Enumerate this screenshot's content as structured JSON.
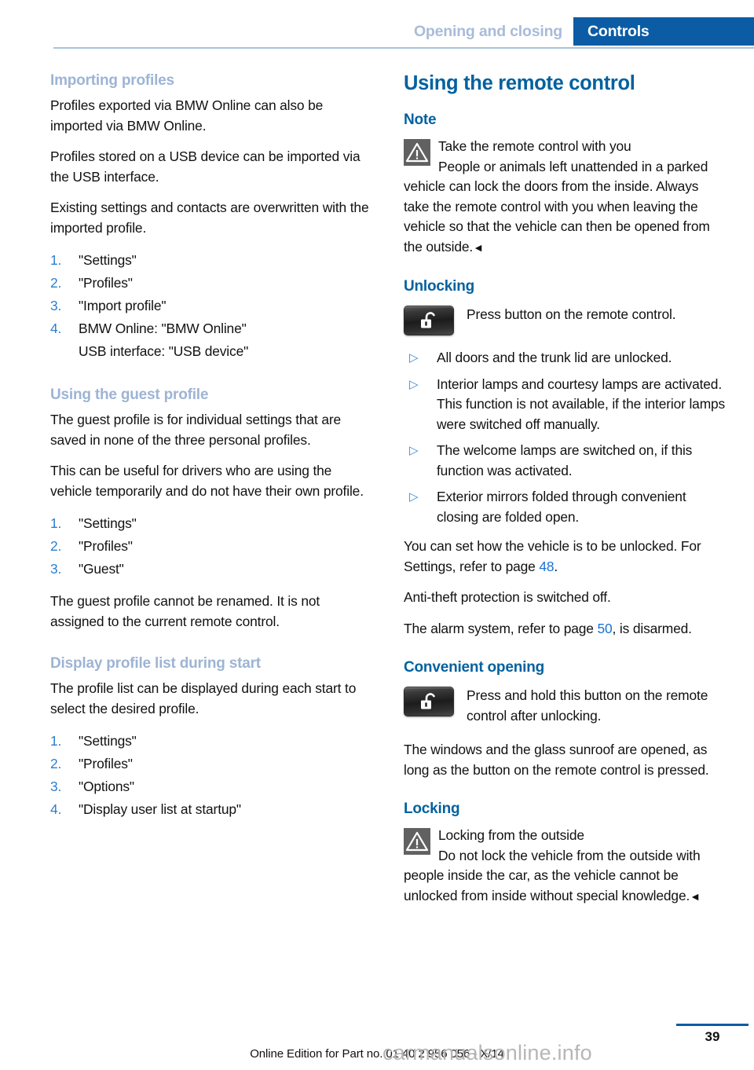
{
  "header": {
    "tab_inactive": "Opening and closing",
    "tab_active": "Controls"
  },
  "left_column": {
    "section_importing": {
      "heading": "Importing profiles",
      "paragraphs": [
        "Profiles exported via BMW Online can also be imported via BMW Online.",
        "Profiles stored on a USB device can be im­ported via the USB interface.",
        "Existing settings and contacts are overwritten with the imported profile."
      ],
      "steps": [
        {
          "num": "1.",
          "text": "\"Settings\""
        },
        {
          "num": "2.",
          "text": "\"Profiles\""
        },
        {
          "num": "3.",
          "text": "\"Import profile\""
        },
        {
          "num": "4.",
          "text": "BMW Online: \"BMW Online\""
        }
      ],
      "step_continuation": "USB interface: \"USB device\""
    },
    "section_guest": {
      "heading": "Using the guest profile",
      "paragraphs": [
        "The guest profile is for individual settings that are saved in none of the three personal pro­files.",
        "This can be useful for drivers who are using the vehicle temporarily and do not have their own profile."
      ],
      "steps": [
        {
          "num": "1.",
          "text": "\"Settings\""
        },
        {
          "num": "2.",
          "text": "\"Profiles\""
        },
        {
          "num": "3.",
          "text": "\"Guest\""
        }
      ],
      "closing": "The guest profile cannot be renamed. It is not assigned to the current remote control."
    },
    "section_display_list": {
      "heading": "Display profile list during start",
      "intro": "The profile list can be displayed during each start to select the desired profile.",
      "steps": [
        {
          "num": "1.",
          "text": "\"Settings\""
        },
        {
          "num": "2.",
          "text": "\"Profiles\""
        },
        {
          "num": "3.",
          "text": "\"Options\""
        },
        {
          "num": "4.",
          "text": "\"Display user list at startup\""
        }
      ]
    }
  },
  "right_column": {
    "title": "Using the remote control",
    "note": {
      "heading": "Note",
      "warning_title": "Take the remote control with you",
      "warning_body": "People or animals left unattended in a parked vehicle can lock the doors from the in­side. Always take the remote control with you when leaving the vehicle so that the vehicle can then be opened from the outside.",
      "end_mark": "◄"
    },
    "unlocking": {
      "heading": "Unlocking",
      "button_text": "Press button on the remote control.",
      "bullets": [
        "All doors and the trunk lid are unlocked.",
        "Interior lamps and courtesy lamps are acti­vated. This function is not available, if the interior lamps were switched off manually.",
        "The welcome lamps are switched on, if this function was activated.",
        "Exterior mirrors folded through convenient closing are folded open."
      ],
      "bullet_mark": "▷",
      "paragraph_settings_pre": "You can set how the vehicle is to be unlocked. For Settings, refer to page ",
      "paragraph_settings_page": "48",
      "paragraph_settings_post": ".",
      "paragraph_antitheft": "Anti-theft protection is switched off.",
      "paragraph_alarm_pre": "The alarm system, refer to page ",
      "paragraph_alarm_page": "50",
      "paragraph_alarm_post": ", is dis­armed."
    },
    "convenient_opening": {
      "heading": "Convenient opening",
      "button_text": "Press and hold this button on the re­mote control after unlocking.",
      "paragraph": "The windows and the glass sunroof are opened, as long as the button on the remote control is pressed."
    },
    "locking": {
      "heading": "Locking",
      "warning_title": "Locking from the outside",
      "warning_body": "Do not lock the vehicle from the outside with people inside the car, as the vehicle can­not be unlocked from inside without special knowledge.",
      "end_mark": "◄"
    }
  },
  "footer": {
    "page_number": "39",
    "note": "Online Edition for Part no. 01 40 2 956 056 - X/14",
    "watermark": "carmanualsonline.info"
  },
  "colors": {
    "accent_blue": "#00619f",
    "tab_blue": "#0b5ca5",
    "light_heading_blue": "#9db4d4",
    "link_blue": "#1a72d6",
    "bullet_blue": "#3a87d8",
    "warn_gray": "#616161"
  }
}
